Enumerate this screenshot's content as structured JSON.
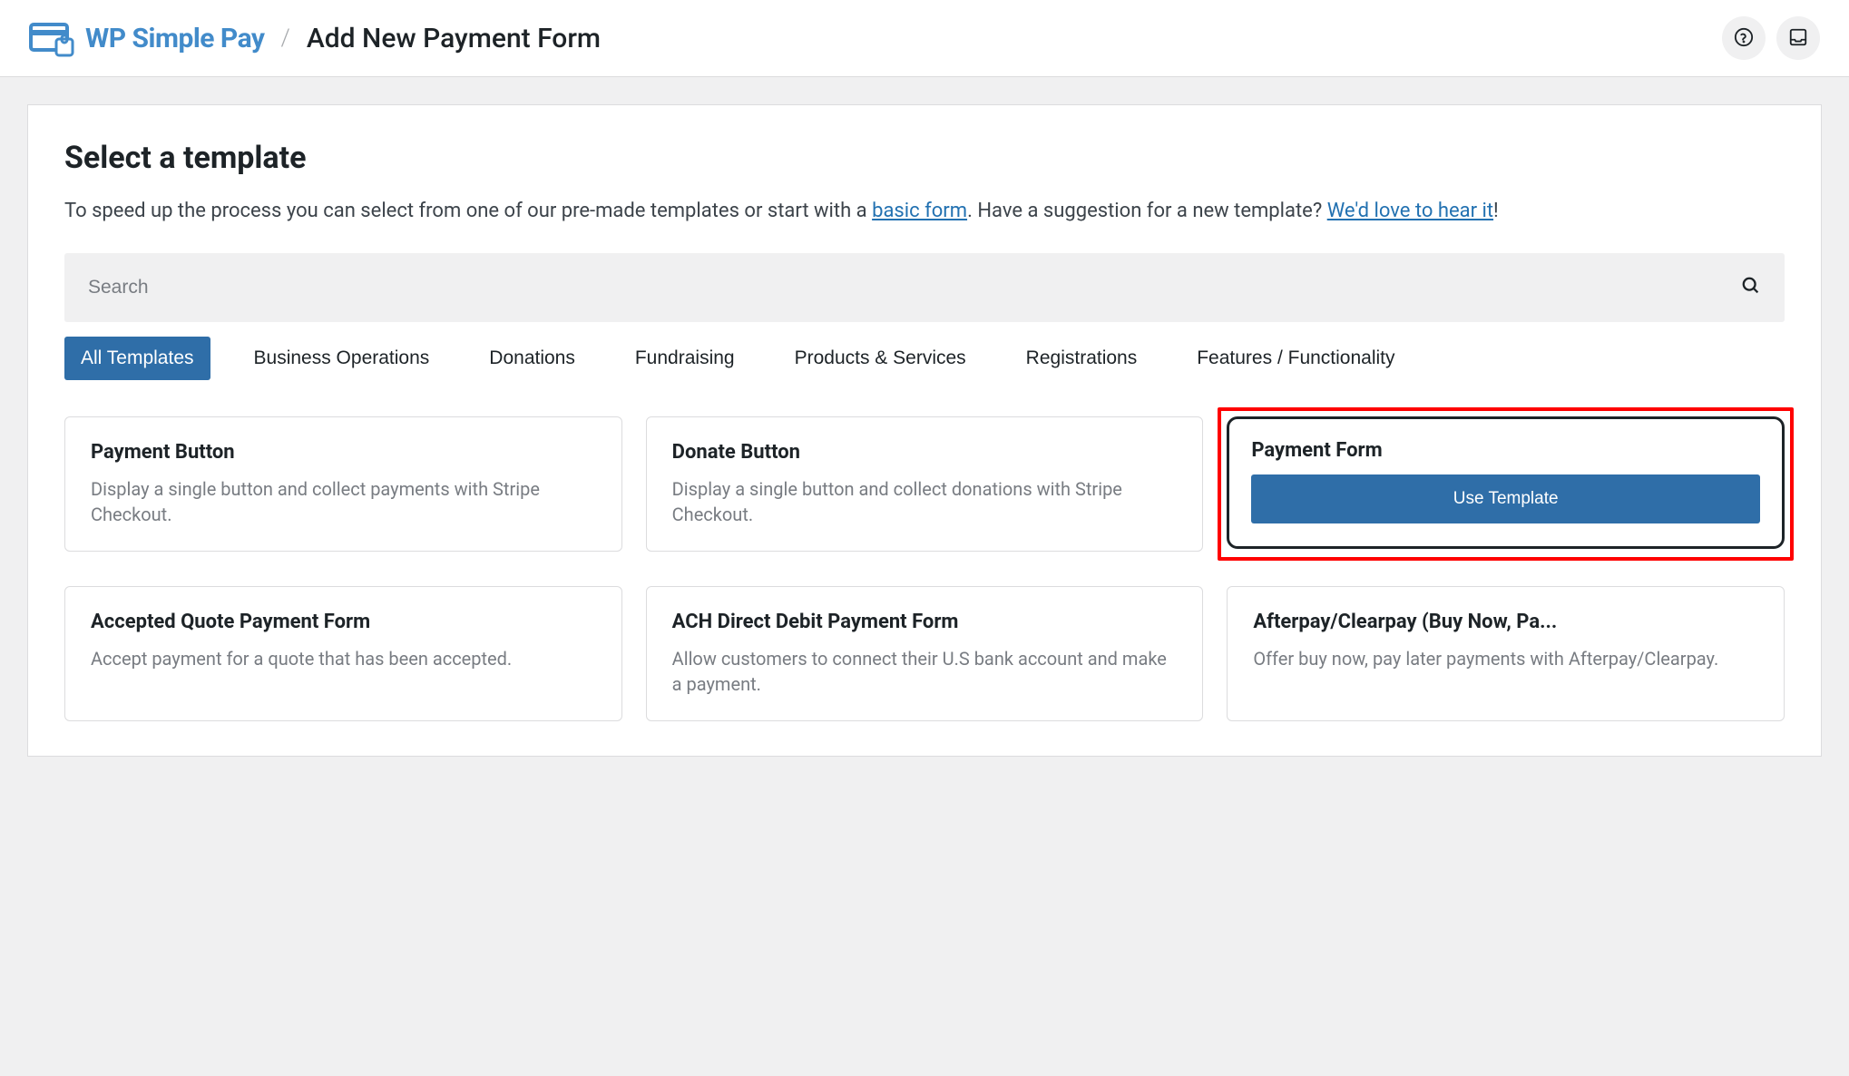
{
  "brand": {
    "name": "WP Simple Pay",
    "slash": "/",
    "page_title": "Add New Payment Form"
  },
  "card": {
    "heading": "Select a template",
    "intro_pre": "To speed up the process you can select from one of our pre-made templates or start with a ",
    "intro_link1": "basic form",
    "intro_mid": ". Have a suggestion for a new template? ",
    "intro_link2": "We'd love to hear it",
    "intro_post": "!"
  },
  "search": {
    "placeholder": "Search"
  },
  "tabs": [
    "All Templates",
    "Business Operations",
    "Donations",
    "Fundraising",
    "Products & Services",
    "Registrations",
    "Features / Functionality"
  ],
  "templates": {
    "row1": [
      {
        "title": "Payment Button",
        "desc": "Display a single button and collect payments with Stripe Checkout."
      },
      {
        "title": "Donate Button",
        "desc": "Display a single button and collect donations with Stripe Checkout."
      },
      {
        "title": "Payment Form",
        "use_label": "Use Template"
      }
    ],
    "row2": [
      {
        "title": "Accepted Quote Payment Form",
        "desc": "Accept payment for a quote that has been accepted."
      },
      {
        "title": "ACH Direct Debit Payment Form",
        "desc": "Allow customers to connect their U.S bank account and make a payment."
      },
      {
        "title": "Afterpay/Clearpay (Buy Now, Pa...",
        "desc": "Offer buy now, pay later payments with Afterpay/Clearpay."
      }
    ]
  }
}
